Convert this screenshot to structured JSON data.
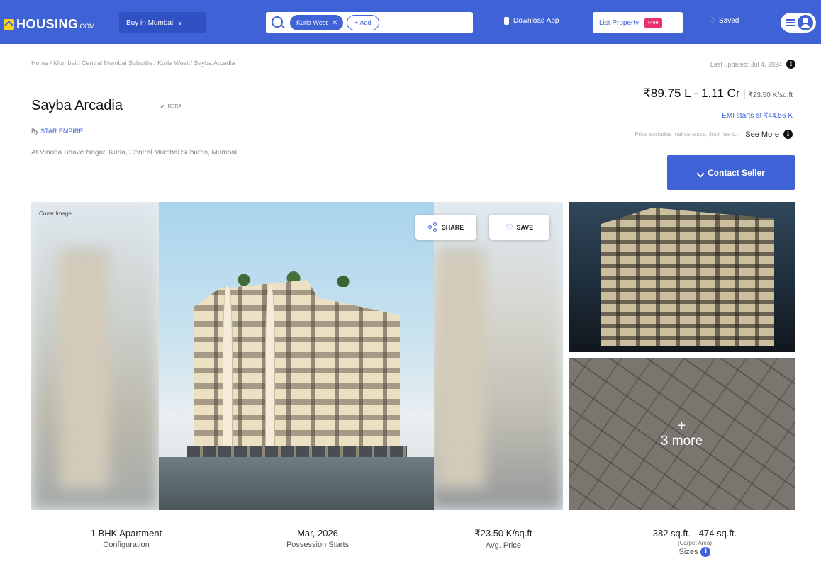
{
  "nav": {
    "logo_text": "HOUSING",
    "logo_suffix": "COM",
    "city_menu": "Buy in Mumbai",
    "search_chip": "Kurla West",
    "add_label": "+ Add",
    "download_app": "Download App",
    "list_property": "List Property",
    "free_badge": "Free",
    "saved": "Saved",
    "colors": {
      "brand": "#3f63d6",
      "free_badge": "#e8316d",
      "logo_mark": "#ffd21f"
    }
  },
  "breadcrumb": "Home / Mumbai / Central Mumbai Suburbs / Kurla West / Sayba Arcadia",
  "last_updated": "Last updated: Jul 4, 2024",
  "project": {
    "title": "Sayba Arcadia",
    "rera": "RERA",
    "builder_prefix": "By",
    "builder_name": "STAR EMPIRE",
    "address": "At Vinoba Bhave Nagar, Kurla, Central Mumbai Suburbs, Mumbai"
  },
  "pricing": {
    "range": "₹89.75 L - 1.11 Cr",
    "separator": "|",
    "per_sqft": "₹23.50 K/sq.ft",
    "emi": "EMI starts at ₹44.56 K",
    "note": "Price excludes maintenance, floor rise c...",
    "see_more": "See More"
  },
  "contact_seller": "Contact Seller",
  "gallery": {
    "cover_label": "Cover Image",
    "share": "SHARE",
    "save": "SAVE",
    "more_plus": "+",
    "more_count": "3 more"
  },
  "stats": [
    {
      "value": "1 BHK Apartment",
      "label": "Configuration"
    },
    {
      "value": "Mar, 2026",
      "label": "Possession Starts"
    },
    {
      "value": "₹23.50 K/sq.ft",
      "label": "Avg. Price"
    },
    {
      "value": "382 sq.ft. - 474 sq.ft.",
      "sub": "(Carpet Area)",
      "label": "Sizes"
    }
  ]
}
